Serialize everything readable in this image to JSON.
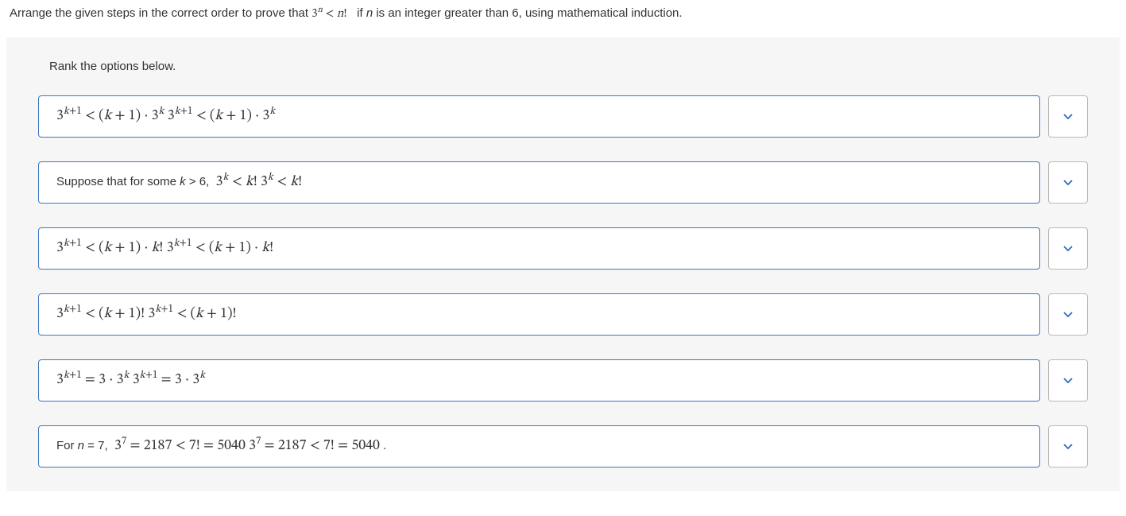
{
  "prompt": {
    "pre": "Arrange the given steps in the correct order to prove that ",
    "math": "3ⁿ < n!",
    "post": " if n is an integer greater than 6, using mathematical induction."
  },
  "instruction": "Rank the options below.",
  "options": [
    {
      "id": "opt-1",
      "html": "3<sup><i>k</i>+1</sup> &lt; (<i>k</i> + 1) · 3<sup><i>k</i></sup>  3<sup><i>k</i>+1</sup> &lt; (<i>k</i> + 1) · 3<sup><i>k</i></sup>"
    },
    {
      "id": "opt-2",
      "html": "<span class='txt'>Suppose that for some <i>k</i> &gt; 6,&nbsp;&nbsp;</span>3<sup><i>k</i></sup> &lt; <i>k</i>! 3<sup><i>k</i></sup> &lt; <i>k</i>!"
    },
    {
      "id": "opt-3",
      "html": "3<sup><i>k</i>+1</sup> &lt; (<i>k</i> + 1) · <i>k</i>! 3<sup><i>k</i>+1</sup> &lt; (<i>k</i> + 1) · <i>k</i>!"
    },
    {
      "id": "opt-4",
      "html": "3<sup><i>k</i>+1</sup> &lt; (<i>k</i> + 1)! 3<sup><i>k</i>+1</sup> &lt; (<i>k</i> + 1)!"
    },
    {
      "id": "opt-5",
      "html": "3<sup><i>k</i>+1</sup> = 3 · 3<sup><i>k</i></sup>  3<sup><i>k</i>+1</sup> = 3 · 3<sup><i>k</i></sup>"
    },
    {
      "id": "opt-6",
      "html": "<span class='txt'>For <i>n</i> = 7,&nbsp;&nbsp;</span>3<sup>7</sup> = 2187 &lt; 7! = 5040 3<sup>7</sup> = 2187 &lt; 7! = 5040<span class='txt'> .</span>"
    }
  ]
}
